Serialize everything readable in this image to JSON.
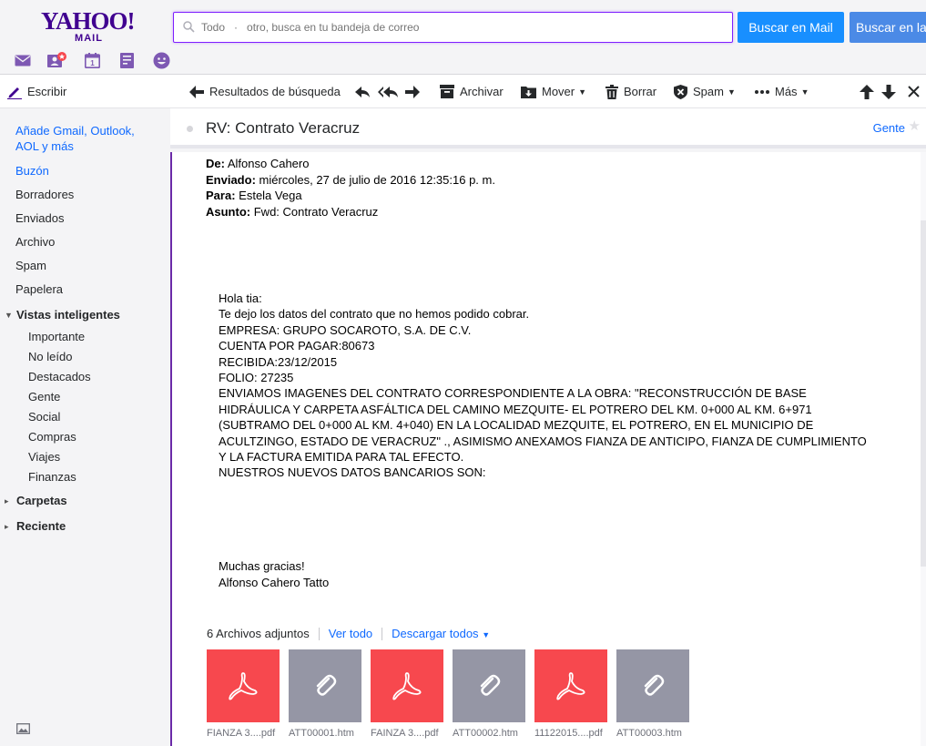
{
  "brand": {
    "logo": "YAHOO!",
    "logo_sub": "MAIL"
  },
  "app_icons": [
    "mail-icon",
    "contacts-icon",
    "calendar-icon",
    "notepad-icon",
    "messenger-icon"
  ],
  "search": {
    "placeholder": "Todo   ·   otro, busca en tu bandeja de correo",
    "btn_mail": "Buscar en Mail",
    "btn_web": "Buscar en la W"
  },
  "toolbar": {
    "compose": "Escribir",
    "back": "Resultados de búsqueda",
    "archive": "Archivar",
    "move": "Mover",
    "delete": "Borrar",
    "spam": "Spam",
    "more": "Más"
  },
  "sidebar": {
    "add_accounts": "Añade Gmail, Outlook, AOL y más",
    "folders": [
      "Buzón",
      "Borradores",
      "Enviados",
      "Archivo",
      "Spam",
      "Papelera"
    ],
    "smart_views_title": "Vistas inteligentes",
    "smart_views": [
      "Importante",
      "No leído",
      "Destacados",
      "Gente",
      "Social",
      "Compras",
      "Viajes",
      "Finanzas"
    ],
    "folders_title": "Carpetas",
    "recent_title": "Reciente"
  },
  "message": {
    "subject": "RV: Contrato Veracruz",
    "people_link": "Gente",
    "from_label": "De:",
    "from": "Alfonso Cahero",
    "sent_label": "Enviado:",
    "sent": "miércoles, 27 de julio de 2016 12:35:16 p. m.",
    "to_label": "Para:",
    "to": "Estela Vega",
    "subject_label": "Asunto:",
    "fwd_subject": "Fwd: Contrato Veracruz",
    "body": [
      "Hola tia:",
      "Te dejo los datos del contrato que no hemos podido cobrar.",
      "EMPRESA: GRUPO SOCAROTO, S.A. DE C.V.",
      "CUENTA POR PAGAR:80673",
      "RECIBIDA:23/12/2015",
      "FOLIO: 27235",
      "ENVIAMOS IMAGENES DEL CONTRATO CORRESPONDIENTE A LA OBRA: \"RECONSTRUCCIÓN DE BASE HIDRÁULICA Y CARPETA ASFÁLTICA DEL CAMINO MEZQUITE- EL POTRERO DEL KM. 0+000 AL KM. 6+971 (SUBTRAMO DEL 0+000 AL KM. 4+040) EN LA LOCALIDAD MEZQUITE, EL POTRERO, EN EL MUNICIPIO DE ACULTZINGO, ESTADO DE VERACRUZ\" ., ASIMISMO ANEXAMOS FIANZA DE ANTICIPO, FIANZA DE CUMPLIMIENTO Y LA FACTURA EMITIDA PARA TAL EFECTO.",
      "NUESTROS NUEVOS DATOS BANCARIOS SON:"
    ],
    "closing": "Muchas gracias!",
    "signature": "Alfonso Cahero Tatto"
  },
  "attachments": {
    "count_label": "6 Archivos adjuntos",
    "view_all": "Ver todo",
    "download_all": "Descargar todos",
    "files": [
      {
        "name": "FIANZA 3....pdf",
        "type": "pdf"
      },
      {
        "name": "ATT00001.htm",
        "type": "file"
      },
      {
        "name": "FAINZA 3....pdf",
        "type": "pdf"
      },
      {
        "name": "ATT00002.htm",
        "type": "file"
      },
      {
        "name": "11122015....pdf",
        "type": "pdf"
      },
      {
        "name": "ATT00003.htm",
        "type": "file"
      }
    ]
  },
  "colors": {
    "brand": "#400090",
    "accent": "#188fff",
    "link": "#0f69ff",
    "pdf": "#f7484e",
    "file": "#9596a5"
  }
}
